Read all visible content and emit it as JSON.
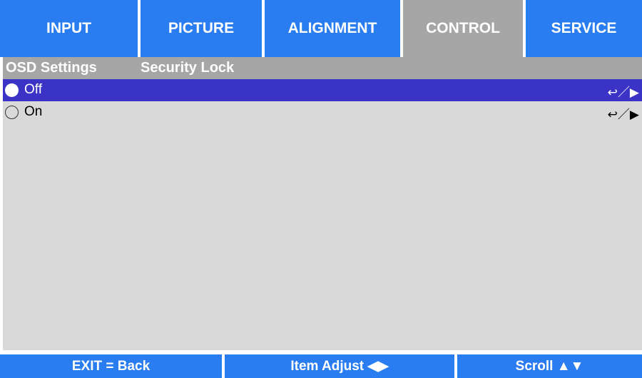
{
  "tabs": [
    {
      "label": "INPUT",
      "active": false
    },
    {
      "label": "PICTURE",
      "active": false
    },
    {
      "label": "ALIGNMENT",
      "active": false
    },
    {
      "label": "CONTROL",
      "active": true
    },
    {
      "label": "SERVICE",
      "active": false
    }
  ],
  "breadcrumb": {
    "section": "OSD Settings",
    "page": "Security Lock"
  },
  "options": [
    {
      "label": "Off",
      "selected": true,
      "hint": "↩／▶"
    },
    {
      "label": "On",
      "selected": false,
      "hint": "↩／▶"
    }
  ],
  "footer": {
    "exit": "EXIT = Back",
    "adjust": "Item Adjust ◀▶",
    "scroll": "Scroll ▲▼"
  },
  "colors": {
    "tab_blue": "#2a7df0",
    "tab_active_gray": "#a6a6a6",
    "panel_gray": "#d9d9d9",
    "selected_row": "#3a33c6"
  }
}
